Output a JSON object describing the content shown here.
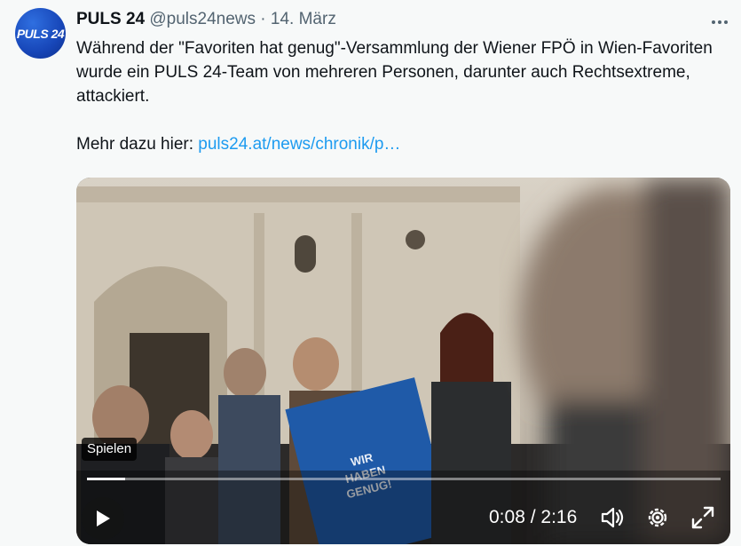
{
  "tweet": {
    "account_name": "PULS 24",
    "handle": "@puls24news",
    "separator": "·",
    "date": "14. März",
    "avatar_text": "PULS 24",
    "text_line1": "Während der \"Favoriten hat genug\"-Versammlung der Wiener FPÖ in Wien-Favoriten wurde ein PULS 24-Team von mehreren Personen, darunter auch Rechtsextreme, attackiert.",
    "more_prefix": "Mehr dazu hier: ",
    "link_text": "puls24.at/news/chronik/p…"
  },
  "video": {
    "badge_label": "Spielen",
    "time_current": "0:08",
    "time_sep": " / ",
    "time_total": "2:16",
    "progress_fraction": 0.06,
    "sign_text": "WIR HABEN GENUG!",
    "icons": [
      "play-icon",
      "volume-icon",
      "settings-icon",
      "fullscreen-icon",
      "more-icon"
    ]
  },
  "colors": {
    "link": "#1d9bf0",
    "text": "#0f1419",
    "muted": "#536471",
    "background": "#f7f9f9"
  }
}
